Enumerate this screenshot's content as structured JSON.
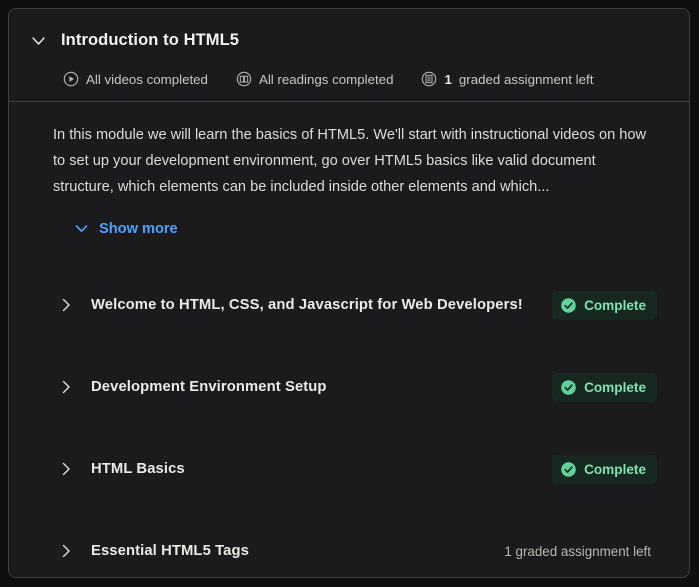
{
  "module": {
    "title": "Introduction to HTML5",
    "collapse_icon": "chevron-down-icon",
    "meta": [
      {
        "icon": "play-circle-icon",
        "text": "All videos completed",
        "strong": ""
      },
      {
        "icon": "book-circle-icon",
        "text": "All readings completed",
        "strong": ""
      },
      {
        "icon": "assignment-circle-icon",
        "text": "graded assignment left",
        "strong": "1"
      }
    ],
    "description": "In this module we will learn the basics of HTML5. We'll start with instructional videos on how to set up your development environment, go over HTML5 basics like valid document structure, which elements can be included inside other elements and which...",
    "show_more_label": "Show more",
    "show_more_icon": "chevron-down-icon",
    "lessons": [
      {
        "title": "Welcome to HTML, CSS, and Javascript for Web Developers!",
        "expand_icon": "chevron-right-icon",
        "status_type": "badge",
        "status_label": "Complete",
        "status_icon": "check-circle-icon"
      },
      {
        "title": "Development Environment Setup",
        "expand_icon": "chevron-right-icon",
        "status_type": "badge",
        "status_label": "Complete",
        "status_icon": "check-circle-icon"
      },
      {
        "title": "HTML Basics",
        "expand_icon": "chevron-right-icon",
        "status_type": "badge",
        "status_label": "Complete",
        "status_icon": "check-circle-icon"
      },
      {
        "title": "Essential HTML5 Tags",
        "expand_icon": "chevron-right-icon",
        "status_type": "note",
        "status_label": "1 graded assignment left",
        "status_icon": ""
      }
    ]
  },
  "colors": {
    "page_background": "#0f0f10",
    "card_background": "#1b1b1d",
    "card_border": "#3f3f44",
    "title_text": "#f2f2f3",
    "body_text": "#dedcd6",
    "muted_text": "#b9b7b1",
    "link_blue": "#4ea1ff",
    "badge_background": "#16281f",
    "badge_text": "#7fe3b0",
    "badge_icon": "#5fd39b"
  }
}
